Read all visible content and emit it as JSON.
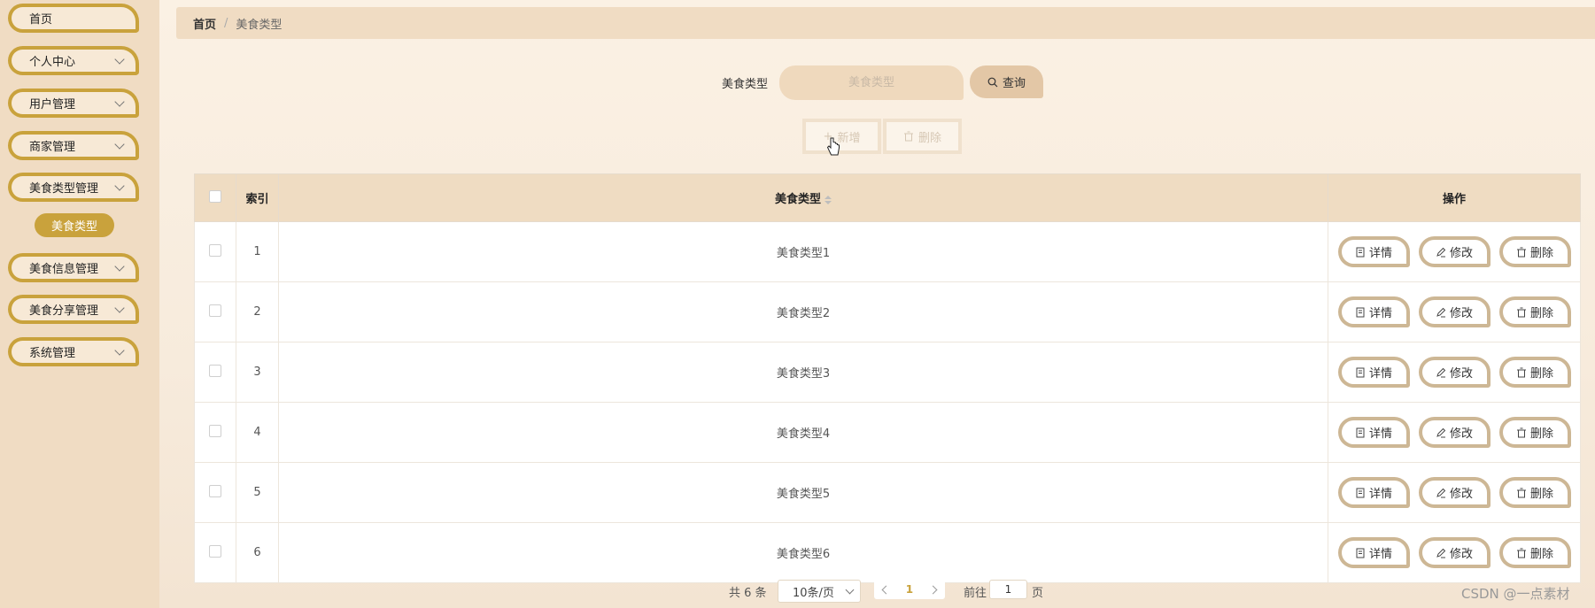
{
  "sidebar": {
    "items": [
      {
        "label": "首页",
        "has_children": false
      },
      {
        "label": "个人中心",
        "has_children": true
      },
      {
        "label": "用户管理",
        "has_children": true
      },
      {
        "label": "商家管理",
        "has_children": true
      },
      {
        "label": "美食类型管理",
        "has_children": true
      },
      {
        "label": "美食信息管理",
        "has_children": true
      },
      {
        "label": "美食分享管理",
        "has_children": true
      },
      {
        "label": "系统管理",
        "has_children": true
      }
    ],
    "active_sub_item": "美食类型"
  },
  "breadcrumb": {
    "home": "首页",
    "separator": "/",
    "current": "美食类型"
  },
  "search": {
    "label": "美食类型",
    "placeholder": "美食类型",
    "value": "",
    "button_label": "查询"
  },
  "actions": {
    "add_label": "新增",
    "delete_label": "删除"
  },
  "table": {
    "columns": {
      "index": "索引",
      "type": "美食类型",
      "ops": "操作"
    },
    "rows": [
      {
        "index": "1",
        "type": "美食类型1"
      },
      {
        "index": "2",
        "type": "美食类型2"
      },
      {
        "index": "3",
        "type": "美食类型3"
      },
      {
        "index": "4",
        "type": "美食类型4"
      },
      {
        "index": "5",
        "type": "美食类型5"
      },
      {
        "index": "6",
        "type": "美食类型6"
      }
    ],
    "row_buttons": {
      "detail": "详情",
      "edit": "修改",
      "delete": "删除"
    }
  },
  "pagination": {
    "total": "共 6 条",
    "page_size": "10条/页",
    "current_page": "1",
    "goto_label": "前往",
    "goto_value": "1",
    "goto_suffix": "页"
  },
  "watermark": "CSDN @一点素材",
  "colors": {
    "accent": "#c9a23c",
    "sidebar_bg": "#f0dcc3",
    "header_bg": "#efdcc2"
  }
}
